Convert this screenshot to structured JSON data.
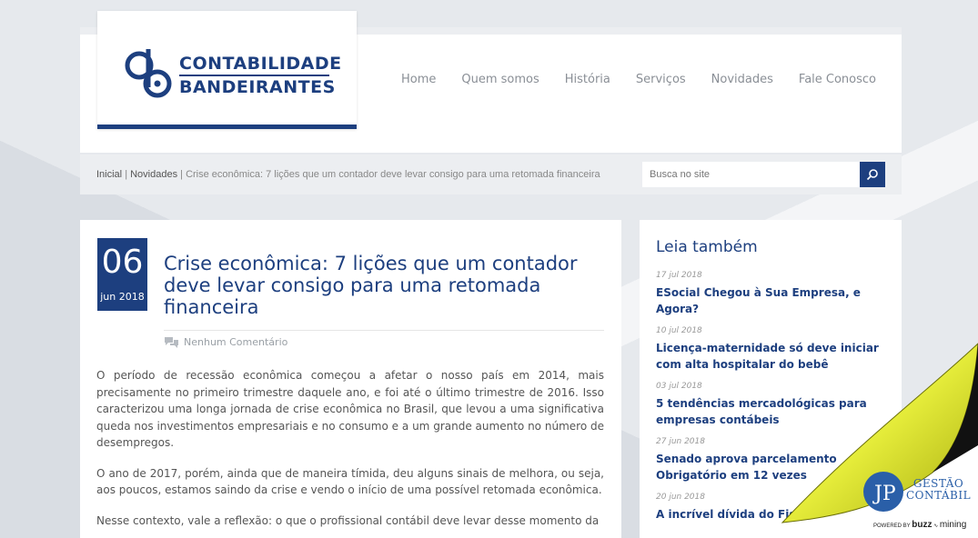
{
  "logo": {
    "line1": "CONTABILIDADE",
    "line2": "BANDEIRANTES",
    "mark_icon": "cb-logo-icon",
    "color": "#1d3f7f"
  },
  "nav": {
    "items": [
      "Home",
      "Quem somos",
      "História",
      "Serviços",
      "Novidades",
      "Fale Conosco"
    ]
  },
  "breadcrumb": {
    "home": "Inicial",
    "section": "Novidades",
    "current": "Crise econômica: 7 lições que um contador deve levar consigo para uma retomada financeira",
    "separator": "|"
  },
  "search": {
    "placeholder": "Busca no site",
    "icon": "search-icon"
  },
  "post": {
    "date_day": "06",
    "date_month": "jun 2018",
    "title": "Crise econômica: 7 lições que um contador deve levar consigo para uma retomada financeira",
    "comments": "Nenhum Comentário",
    "paragraphs": [
      "O período de recessão econômica começou a afetar o nosso país em 2014, mais precisamente no primeiro trimestre daquele ano, e foi até o último trimestre de 2016. Isso caracterizou uma longa jornada de crise econômica no Brasil, que levou a uma significativa queda nos investimentos empresariais e no consumo e a um grande aumento no número de desempregos.",
      "O ano de 2017, porém, ainda que de maneira tímida, deu alguns sinais de melhora, ou seja, aos poucos, estamos saindo da crise e vendo o início de uma possível retomada econômica.",
      "Nesse contexto, vale a reflexão: o que o profissional contábil deve levar desse momento da"
    ]
  },
  "sidebar": {
    "title": "Leia também",
    "items": [
      {
        "date": "17 jul 2018",
        "title": "ESocial Chegou à Sua Empresa, e Agora?"
      },
      {
        "date": "10 jul 2018",
        "title": "Licença-maternidade só deve iniciar com alta hospitalar do bebê"
      },
      {
        "date": "03 jul 2018",
        "title": "5 tendências mercadológicas para empresas contábeis"
      },
      {
        "date": "27 jun 2018",
        "title": "Senado aprova parcelamento Obrigatório em 12 vezes"
      },
      {
        "date": "20 jun 2018",
        "title": "A incrível dívida do Fisco"
      }
    ]
  },
  "badge": {
    "line1": "GESTÃO",
    "line2": "CONTÁBIL",
    "powered_by": "POWERED BY",
    "buzz": "buzz",
    "mining": "mining"
  }
}
